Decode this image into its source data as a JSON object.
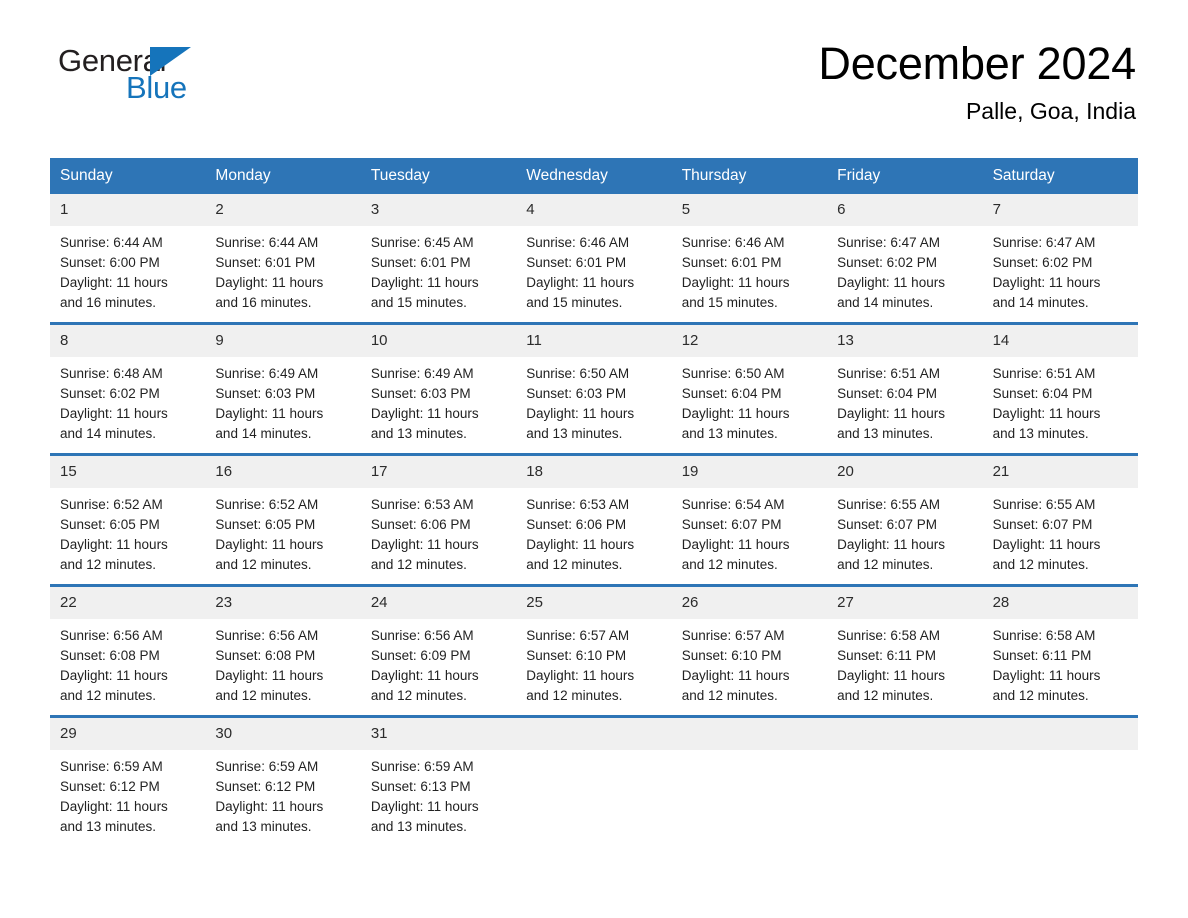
{
  "brand": {
    "name_part1": "General",
    "name_part2": "Blue",
    "triangle_color": "#1574bb"
  },
  "header": {
    "title": "December 2024",
    "location": "Palle, Goa, India"
  },
  "theme": {
    "header_blue": "#2e75b6",
    "day_band_gray": "#f0f0f0",
    "text": "#222222"
  },
  "weekdays": [
    "Sunday",
    "Monday",
    "Tuesday",
    "Wednesday",
    "Thursday",
    "Friday",
    "Saturday"
  ],
  "weeks": [
    [
      {
        "day": "1",
        "sunrise": "Sunrise: 6:44 AM",
        "sunset": "Sunset: 6:00 PM",
        "daylight_line1": "Daylight: 11 hours",
        "daylight_line2": "and 16 minutes."
      },
      {
        "day": "2",
        "sunrise": "Sunrise: 6:44 AM",
        "sunset": "Sunset: 6:01 PM",
        "daylight_line1": "Daylight: 11 hours",
        "daylight_line2": "and 16 minutes."
      },
      {
        "day": "3",
        "sunrise": "Sunrise: 6:45 AM",
        "sunset": "Sunset: 6:01 PM",
        "daylight_line1": "Daylight: 11 hours",
        "daylight_line2": "and 15 minutes."
      },
      {
        "day": "4",
        "sunrise": "Sunrise: 6:46 AM",
        "sunset": "Sunset: 6:01 PM",
        "daylight_line1": "Daylight: 11 hours",
        "daylight_line2": "and 15 minutes."
      },
      {
        "day": "5",
        "sunrise": "Sunrise: 6:46 AM",
        "sunset": "Sunset: 6:01 PM",
        "daylight_line1": "Daylight: 11 hours",
        "daylight_line2": "and 15 minutes."
      },
      {
        "day": "6",
        "sunrise": "Sunrise: 6:47 AM",
        "sunset": "Sunset: 6:02 PM",
        "daylight_line1": "Daylight: 11 hours",
        "daylight_line2": "and 14 minutes."
      },
      {
        "day": "7",
        "sunrise": "Sunrise: 6:47 AM",
        "sunset": "Sunset: 6:02 PM",
        "daylight_line1": "Daylight: 11 hours",
        "daylight_line2": "and 14 minutes."
      }
    ],
    [
      {
        "day": "8",
        "sunrise": "Sunrise: 6:48 AM",
        "sunset": "Sunset: 6:02 PM",
        "daylight_line1": "Daylight: 11 hours",
        "daylight_line2": "and 14 minutes."
      },
      {
        "day": "9",
        "sunrise": "Sunrise: 6:49 AM",
        "sunset": "Sunset: 6:03 PM",
        "daylight_line1": "Daylight: 11 hours",
        "daylight_line2": "and 14 minutes."
      },
      {
        "day": "10",
        "sunrise": "Sunrise: 6:49 AM",
        "sunset": "Sunset: 6:03 PM",
        "daylight_line1": "Daylight: 11 hours",
        "daylight_line2": "and 13 minutes."
      },
      {
        "day": "11",
        "sunrise": "Sunrise: 6:50 AM",
        "sunset": "Sunset: 6:03 PM",
        "daylight_line1": "Daylight: 11 hours",
        "daylight_line2": "and 13 minutes."
      },
      {
        "day": "12",
        "sunrise": "Sunrise: 6:50 AM",
        "sunset": "Sunset: 6:04 PM",
        "daylight_line1": "Daylight: 11 hours",
        "daylight_line2": "and 13 minutes."
      },
      {
        "day": "13",
        "sunrise": "Sunrise: 6:51 AM",
        "sunset": "Sunset: 6:04 PM",
        "daylight_line1": "Daylight: 11 hours",
        "daylight_line2": "and 13 minutes."
      },
      {
        "day": "14",
        "sunrise": "Sunrise: 6:51 AM",
        "sunset": "Sunset: 6:04 PM",
        "daylight_line1": "Daylight: 11 hours",
        "daylight_line2": "and 13 minutes."
      }
    ],
    [
      {
        "day": "15",
        "sunrise": "Sunrise: 6:52 AM",
        "sunset": "Sunset: 6:05 PM",
        "daylight_line1": "Daylight: 11 hours",
        "daylight_line2": "and 12 minutes."
      },
      {
        "day": "16",
        "sunrise": "Sunrise: 6:52 AM",
        "sunset": "Sunset: 6:05 PM",
        "daylight_line1": "Daylight: 11 hours",
        "daylight_line2": "and 12 minutes."
      },
      {
        "day": "17",
        "sunrise": "Sunrise: 6:53 AM",
        "sunset": "Sunset: 6:06 PM",
        "daylight_line1": "Daylight: 11 hours",
        "daylight_line2": "and 12 minutes."
      },
      {
        "day": "18",
        "sunrise": "Sunrise: 6:53 AM",
        "sunset": "Sunset: 6:06 PM",
        "daylight_line1": "Daylight: 11 hours",
        "daylight_line2": "and 12 minutes."
      },
      {
        "day": "19",
        "sunrise": "Sunrise: 6:54 AM",
        "sunset": "Sunset: 6:07 PM",
        "daylight_line1": "Daylight: 11 hours",
        "daylight_line2": "and 12 minutes."
      },
      {
        "day": "20",
        "sunrise": "Sunrise: 6:55 AM",
        "sunset": "Sunset: 6:07 PM",
        "daylight_line1": "Daylight: 11 hours",
        "daylight_line2": "and 12 minutes."
      },
      {
        "day": "21",
        "sunrise": "Sunrise: 6:55 AM",
        "sunset": "Sunset: 6:07 PM",
        "daylight_line1": "Daylight: 11 hours",
        "daylight_line2": "and 12 minutes."
      }
    ],
    [
      {
        "day": "22",
        "sunrise": "Sunrise: 6:56 AM",
        "sunset": "Sunset: 6:08 PM",
        "daylight_line1": "Daylight: 11 hours",
        "daylight_line2": "and 12 minutes."
      },
      {
        "day": "23",
        "sunrise": "Sunrise: 6:56 AM",
        "sunset": "Sunset: 6:08 PM",
        "daylight_line1": "Daylight: 11 hours",
        "daylight_line2": "and 12 minutes."
      },
      {
        "day": "24",
        "sunrise": "Sunrise: 6:56 AM",
        "sunset": "Sunset: 6:09 PM",
        "daylight_line1": "Daylight: 11 hours",
        "daylight_line2": "and 12 minutes."
      },
      {
        "day": "25",
        "sunrise": "Sunrise: 6:57 AM",
        "sunset": "Sunset: 6:10 PM",
        "daylight_line1": "Daylight: 11 hours",
        "daylight_line2": "and 12 minutes."
      },
      {
        "day": "26",
        "sunrise": "Sunrise: 6:57 AM",
        "sunset": "Sunset: 6:10 PM",
        "daylight_line1": "Daylight: 11 hours",
        "daylight_line2": "and 12 minutes."
      },
      {
        "day": "27",
        "sunrise": "Sunrise: 6:58 AM",
        "sunset": "Sunset: 6:11 PM",
        "daylight_line1": "Daylight: 11 hours",
        "daylight_line2": "and 12 minutes."
      },
      {
        "day": "28",
        "sunrise": "Sunrise: 6:58 AM",
        "sunset": "Sunset: 6:11 PM",
        "daylight_line1": "Daylight: 11 hours",
        "daylight_line2": "and 12 minutes."
      }
    ],
    [
      {
        "day": "29",
        "sunrise": "Sunrise: 6:59 AM",
        "sunset": "Sunset: 6:12 PM",
        "daylight_line1": "Daylight: 11 hours",
        "daylight_line2": "and 13 minutes."
      },
      {
        "day": "30",
        "sunrise": "Sunrise: 6:59 AM",
        "sunset": "Sunset: 6:12 PM",
        "daylight_line1": "Daylight: 11 hours",
        "daylight_line2": "and 13 minutes."
      },
      {
        "day": "31",
        "sunrise": "Sunrise: 6:59 AM",
        "sunset": "Sunset: 6:13 PM",
        "daylight_line1": "Daylight: 11 hours",
        "daylight_line2": "and 13 minutes."
      },
      {
        "day": "",
        "sunrise": "",
        "sunset": "",
        "daylight_line1": "",
        "daylight_line2": ""
      },
      {
        "day": "",
        "sunrise": "",
        "sunset": "",
        "daylight_line1": "",
        "daylight_line2": ""
      },
      {
        "day": "",
        "sunrise": "",
        "sunset": "",
        "daylight_line1": "",
        "daylight_line2": ""
      },
      {
        "day": "",
        "sunrise": "",
        "sunset": "",
        "daylight_line1": "",
        "daylight_line2": ""
      }
    ]
  ]
}
